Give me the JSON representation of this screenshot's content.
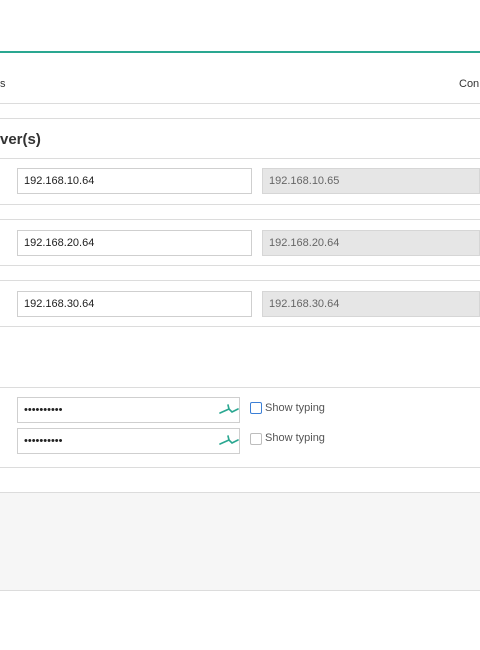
{
  "header": {
    "left_fragment": "s",
    "right_fragment": "Con"
  },
  "section": {
    "title_fragment": "ver(s)"
  },
  "servers": [
    {
      "primary": "192.168.10.64",
      "secondary": "192.168.10.65"
    },
    {
      "primary": "192.168.20.64",
      "secondary": "192.168.20.64"
    },
    {
      "primary": "192.168.30.64",
      "secondary": "192.168.30.64"
    }
  ],
  "password": {
    "masked_1": "••••••••••",
    "masked_2": "••••••••••",
    "show_typing_label": "Show typing"
  },
  "colors": {
    "accent": "#2aa791",
    "focus": "#3b7fd6"
  }
}
